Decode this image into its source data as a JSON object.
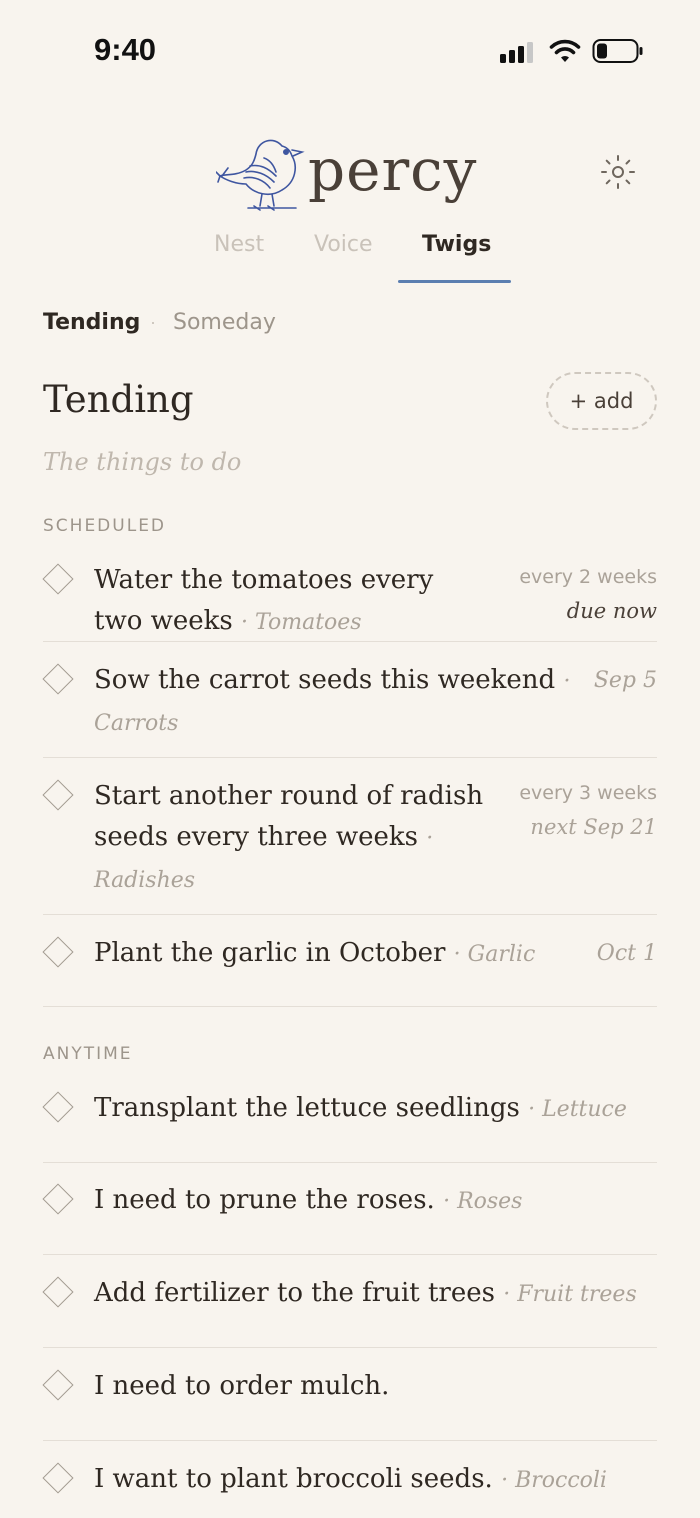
{
  "status_bar": {
    "time": "9:40"
  },
  "brand": {
    "name": "percy"
  },
  "main_tabs": [
    {
      "label": "Nest",
      "active": false
    },
    {
      "label": "Voice",
      "active": false
    },
    {
      "label": "Twigs",
      "active": true
    }
  ],
  "sub_tabs": [
    {
      "label": "Tending",
      "active": true
    },
    {
      "label": "Someday",
      "active": false
    }
  ],
  "section": {
    "title": "Tending",
    "subtitle": "The things to do",
    "add_label": "+ add"
  },
  "groups": {
    "scheduled_label": "SCHEDULED",
    "anytime_label": "ANYTIME"
  },
  "scheduled": [
    {
      "line1": "Water the tomatoes every",
      "line2": "two weeks",
      "tag": "· Tomatoes",
      "cadence": "every 2 weeks",
      "due": "due now"
    },
    {
      "line1": "Sow the carrot seeds this weekend",
      "dot": "·",
      "tag": "Carrots",
      "date": "Sep 5"
    },
    {
      "line1": "Start another round of radish",
      "line2": "seeds every three weeks",
      "dot": "·",
      "tag": "Radishes",
      "cadence": "every 3 weeks",
      "due": "next Sep 21"
    },
    {
      "line1": "Plant the garlic in October",
      "tag": "· Garlic",
      "date": "Oct 1"
    }
  ],
  "anytime": [
    {
      "line1": "Transplant the lettuce seedlings",
      "tag": "· Lettuce"
    },
    {
      "line1": "I need to prune the roses.",
      "tag": "· Roses"
    },
    {
      "line1": "Add fertilizer to the fruit trees",
      "tag": "· Fruit trees"
    },
    {
      "line1": "I need to order mulch.",
      "tag": ""
    },
    {
      "line1": "I want to plant broccoli seeds.",
      "tag": "· Broccoli"
    }
  ],
  "colors": {
    "accent": "#5b7eb0",
    "background": "#f8f4ee",
    "text": "#2f2822",
    "muted": "#aaa298"
  }
}
